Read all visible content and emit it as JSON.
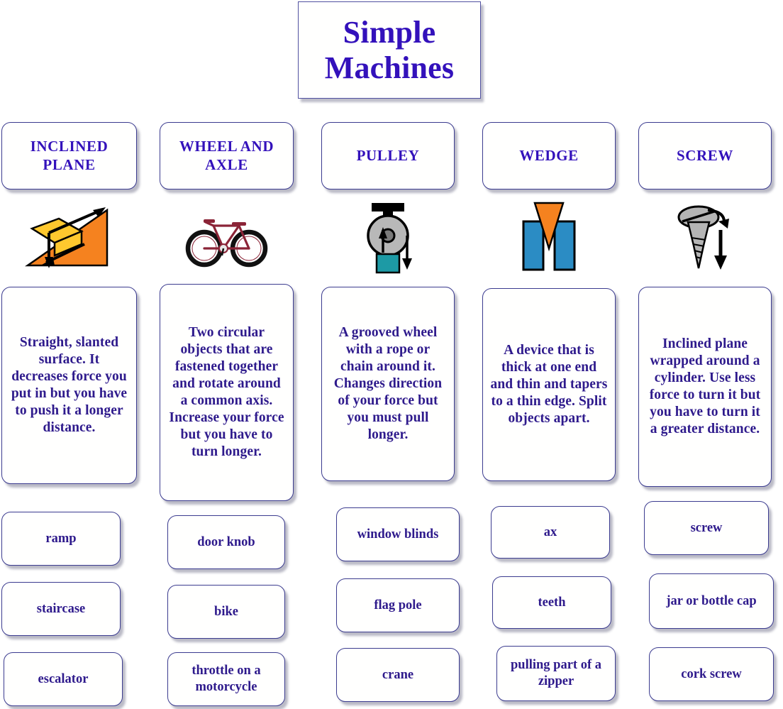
{
  "title": {
    "line1": "Simple",
    "line2": "Machines",
    "color": "#3311bb"
  },
  "theme": {
    "heading_color": "#3311bb",
    "body_text_color": "#2e1a8c",
    "border_color": "#3b3b8f",
    "background": "#ffffff"
  },
  "columns": [
    {
      "heading": "INCLINED PLANE",
      "heading_lines": [
        "INCLINED",
        "PLANE"
      ],
      "icon": "inclined-plane-icon",
      "icon_colors": {
        "ramp": "#f5821f",
        "block": "#ffc82e",
        "arrow": "#000000"
      },
      "description": "Straight, slanted surface. It decreases force you put in but you have to push it a longer distance.",
      "examples": [
        "ramp",
        "staircase",
        "escalator"
      ]
    },
    {
      "heading": "WHEEL AND AXLE",
      "heading_lines": [
        "WHEEL AND",
        "AXLE"
      ],
      "icon": "bicycle-icon",
      "icon_colors": {
        "frame": "#8b2437",
        "tire": "#101010",
        "hub": "#d9d9d9"
      },
      "description": "Two circular objects that are fastened together and rotate around a common axis. Increase your force but you have to turn longer.",
      "examples": [
        "door knob",
        "bike",
        "throttle on a motorcycle"
      ]
    },
    {
      "heading": "PULLEY",
      "heading_lines": [
        "PULLEY"
      ],
      "icon": "pulley-icon",
      "icon_colors": {
        "wheel": "#b8b8b8",
        "mount": "#000000",
        "load": "#1d9aa5"
      },
      "description": "A grooved wheel with a rope or chain around it. Changes direction of your force but you must pull longer.",
      "examples": [
        "window blinds",
        "flag pole",
        "crane"
      ]
    },
    {
      "heading": "WEDGE",
      "heading_lines": [
        "WEDGE"
      ],
      "icon": "wedge-icon",
      "icon_colors": {
        "wedge": "#f5821f",
        "blocks": "#2b8cc4"
      },
      "description": "A device that is thick at one end and thin and tapers to a thin edge. Split objects apart.",
      "examples": [
        "ax",
        "teeth",
        "pulling part of a zipper"
      ]
    },
    {
      "heading": "SCREW",
      "heading_lines": [
        "SCREW"
      ],
      "icon": "screw-icon",
      "icon_colors": {
        "body": "#b5b5b5",
        "outline": "#000000"
      },
      "description": "Inclined plane wrapped around a cylinder. Use less force to turn it but you have to turn it a greater distance.",
      "examples": [
        "screw",
        "jar or bottle cap",
        "cork screw"
      ]
    }
  ]
}
